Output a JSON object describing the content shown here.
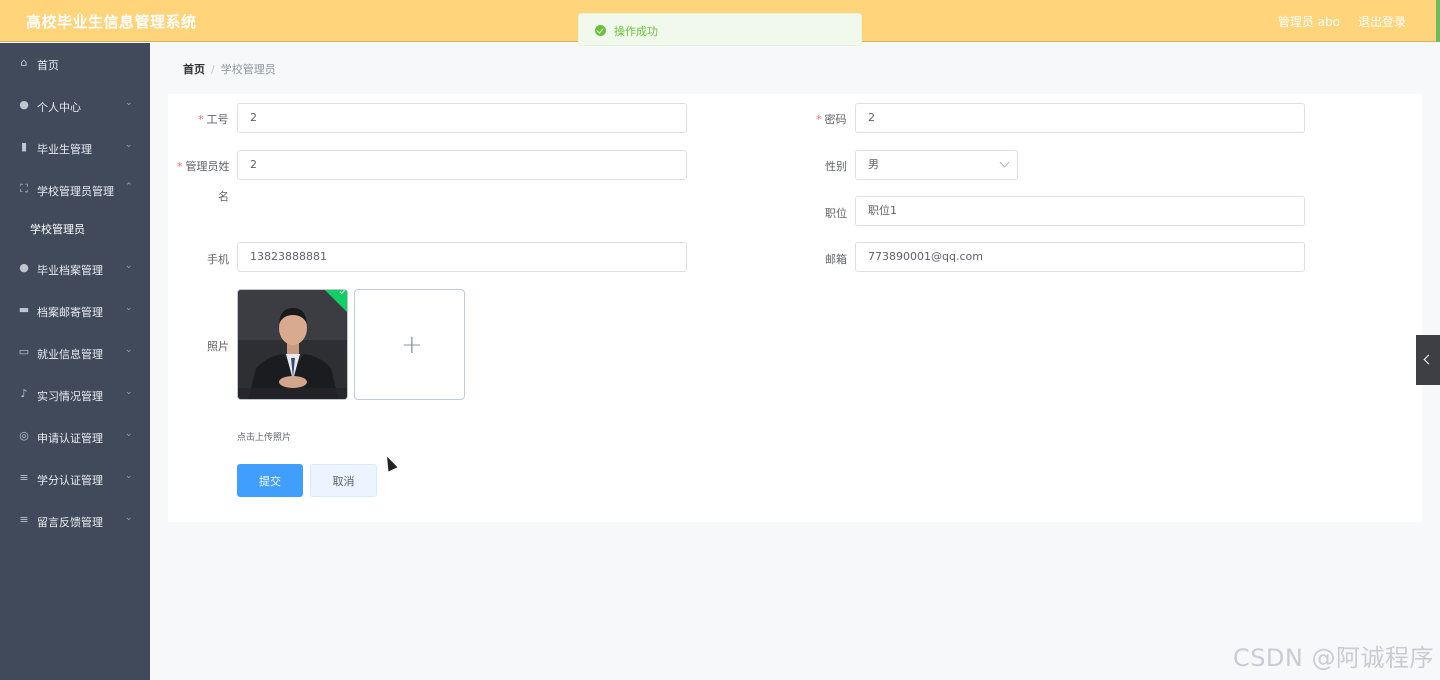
{
  "header": {
    "app_title": "高校毕业生信息管理系统",
    "user": "管理员 abo",
    "logout": "退出登录"
  },
  "toast": {
    "message": "操作成功",
    "icon": "success-check-icon",
    "color": "#67c23a"
  },
  "sidebar": {
    "items": [
      {
        "label": "首页",
        "icon": "home-icon",
        "expandable": false
      },
      {
        "label": "个人中心",
        "icon": "user-icon",
        "expandable": true
      },
      {
        "label": "毕业生管理",
        "icon": "clipboard-icon",
        "expandable": true
      },
      {
        "label": "学校管理员管理",
        "icon": "frame-icon",
        "expandable": true,
        "expanded": true
      },
      {
        "label": "毕业档案管理",
        "icon": "user-icon",
        "expandable": true
      },
      {
        "label": "档案邮寄管理",
        "icon": "briefcase-icon",
        "expandable": true
      },
      {
        "label": "就业信息管理",
        "icon": "chat-icon",
        "expandable": true
      },
      {
        "label": "实习情况管理",
        "icon": "microphone-icon",
        "expandable": true
      },
      {
        "label": "申请认证管理",
        "icon": "compass-icon",
        "expandable": true
      },
      {
        "label": "学分认证管理",
        "icon": "menu-icon",
        "expandable": true
      },
      {
        "label": "留言反馈管理",
        "icon": "menu-icon",
        "expandable": true
      }
    ],
    "subitem": "学校管理员"
  },
  "breadcrumb": {
    "home": "首页",
    "separator": "/",
    "current": "学校管理员"
  },
  "form": {
    "employee_no": {
      "label": "工号",
      "value": "2",
      "required": true
    },
    "password": {
      "label": "密码",
      "value": "2",
      "required": true
    },
    "admin_name": {
      "label_line1": "管理员姓",
      "label_line2": "名",
      "value": "2",
      "required": true
    },
    "gender": {
      "label": "性别",
      "value": "男"
    },
    "position": {
      "label": "职位",
      "value": "职位1"
    },
    "phone": {
      "label": "手机",
      "value": "13823888881"
    },
    "email": {
      "label": "邮箱",
      "value": "773890001@qq.com"
    },
    "photo": {
      "label": "照片",
      "tip": "点击上传照片"
    },
    "submit": "提交",
    "cancel": "取消"
  },
  "colors": {
    "header_bg": "#ffd47a",
    "sidebar_bg": "#414a5a",
    "primary": "#409eff",
    "required": "#f56c6c"
  },
  "watermark": "CSDN @阿诚程序"
}
